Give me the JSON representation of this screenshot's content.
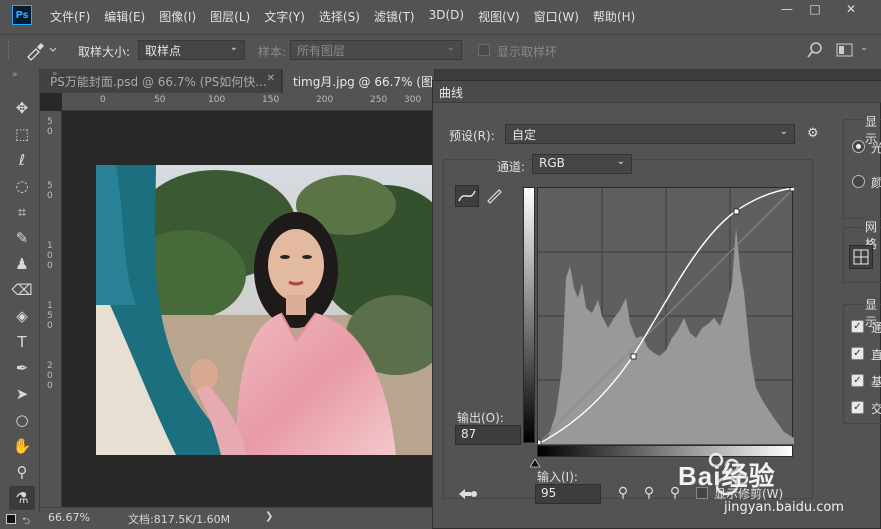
{
  "app": {
    "logo": "Ps"
  },
  "menu": [
    "文件(F)",
    "编辑(E)",
    "图像(I)",
    "图层(L)",
    "文字(Y)",
    "选择(S)",
    "滤镜(T)",
    "3D(D)",
    "视图(V)",
    "窗口(W)",
    "帮助(H)"
  ],
  "window_controls": {
    "minimize": "—",
    "restore": "□",
    "close": "✕"
  },
  "options": {
    "sample_size_label": "取样大小:",
    "sample_size_value": "取样点",
    "sample_label": "样本:",
    "sample_value": "所有图层",
    "show_ring_label": "显示取样环"
  },
  "tabs": [
    {
      "label": "PS万能封面.psd @ 66.7% (PS如何快...",
      "close": "✕"
    },
    {
      "label": "timg月.jpg @ 66.7% (图层",
      "close": "✕"
    }
  ],
  "ruler": {
    "top": [
      "0",
      "50",
      "100",
      "150",
      "200",
      "250",
      "300"
    ],
    "left": [
      "5",
      "0",
      "5",
      "0",
      "1",
      "0",
      "0",
      "1",
      "5",
      "0",
      "2",
      "0",
      "0"
    ]
  },
  "status": {
    "zoom": "66.67%",
    "doc": "文档:817.5K/1.60M",
    "arrow": "❯"
  },
  "dialog": {
    "title": "曲线",
    "preset_label": "预设(R):",
    "preset_value": "自定",
    "channel_label": "通道:",
    "channel_value": "RGB",
    "output_label": "输出(O):",
    "output_value": "87",
    "input_label": "输入(I):",
    "input_value": "95",
    "show_clipping_label": "显示修剪(W)",
    "right_panel": {
      "show_header": "显示",
      "light_option": "光",
      "pigment_option": "颜",
      "grid_header": "网格",
      "display_header": "显示",
      "checks": [
        "通",
        "直",
        "基",
        "交"
      ]
    }
  },
  "watermark": {
    "brand": "Bai经验",
    "url": "jingyan.baidu.com"
  }
}
